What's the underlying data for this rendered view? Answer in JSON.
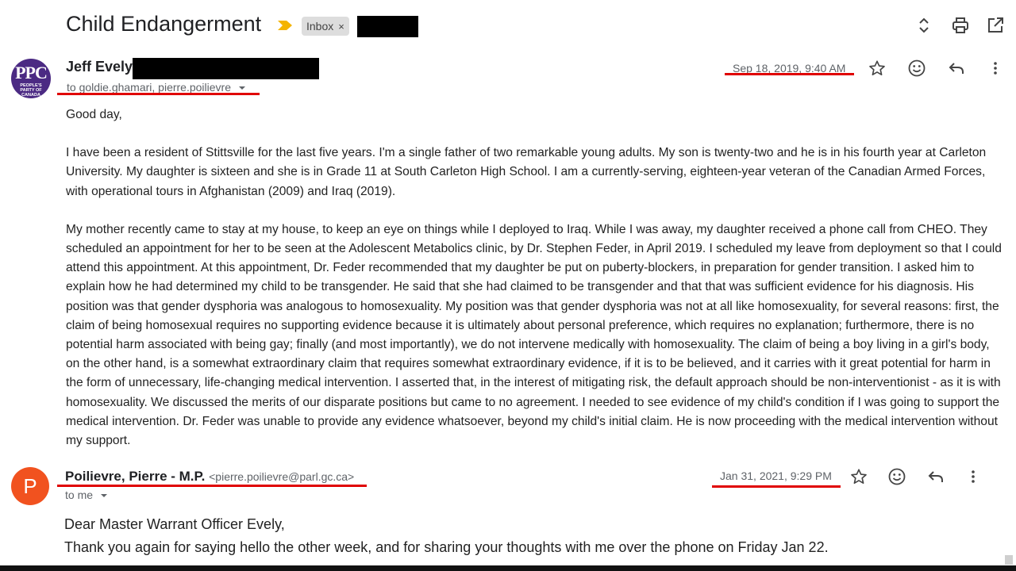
{
  "thread": {
    "subject": "Child Endangerment",
    "label_chip": "Inbox",
    "label_chip_close": "×"
  },
  "message1": {
    "sender_name": "Jeff Evely",
    "avatar_text": "PPC",
    "avatar_subtext": "PEOPLE'S PARTY OF CANADA",
    "recipients": "to goldie.ghamari, pierre.poilievre",
    "date": "Sep 18, 2019, 9:40 AM",
    "body": [
      "Good day,",
      "I have been a resident of Stittsville for the last five years. I'm a single father of two remarkable young adults. My son is twenty-two and he is in his fourth year at Carleton University. My daughter is sixteen and she is in Grade 11 at South Carleton High School. I am a currently-serving, eighteen-year veteran of the Canadian Armed Forces, with operational tours in Afghanistan (2009) and Iraq (2019).",
      "My mother recently came to stay at my house, to keep an eye on things while I deployed to Iraq. While I was away, my daughter received a phone call from CHEO. They scheduled an appointment for her to be seen at the Adolescent Metabolics clinic, by Dr. Stephen Feder, in April 2019. I scheduled my leave from deployment so that I could attend this appointment. At this appointment, Dr. Feder recommended that my daughter be put on puberty-blockers, in preparation for gender transition. I asked him to explain how he had determined my child to be transgender. He said that she had claimed to be transgender and that that was sufficient evidence for his diagnosis. His position was that gender dysphoria was analogous to homosexuality. My position was that gender dysphoria was not at all like homosexuality, for several reasons: first, the claim of being homosexual requires no supporting evidence because it is ultimately about personal preference, which requires no explanation; furthermore, there is no potential harm associated with being gay; finally (and most importantly), we do not intervene medically with homosexuality. The claim of being a boy living in a girl's body, on the other hand, is a somewhat extraordinary claim that requires somewhat extraordinary evidence, if it is to be believed, and it carries with it great potential for harm in the form of unnecessary, life-changing medical intervention. I asserted that, in the interest of mitigating risk, the default approach should be non-interventionist - as it is with homosexuality. We discussed the merits of our disparate positions but came to no agreement. I needed to see evidence of my child's condition if I was going to support the medical intervention. Dr. Feder was unable to provide any evidence whatsoever, beyond my child's initial claim. He is now proceeding with the medical intervention without my support."
    ]
  },
  "message2": {
    "sender_name": "Poilievre, Pierre - M.P.",
    "sender_email": "<pierre.poilievre@parl.gc.ca>",
    "avatar_letter": "P",
    "recipients": "to me",
    "date": "Jan 31, 2021, 9:29 PM",
    "body": [
      "Dear Master Warrant Officer Evely,",
      "Thank you again for saying hello the other week, and for sharing your thoughts with me over the phone on Friday Jan 22."
    ]
  },
  "icons": {
    "thread_toolbar": [
      "expand-collapse-icon",
      "print-icon",
      "open-in-new-window-icon"
    ],
    "message_actions": [
      "star-icon",
      "emoji-reaction-icon",
      "reply-icon",
      "more-vert-icon"
    ]
  },
  "colors": {
    "importance_marker": "#f4b400",
    "avatar_ppc": "#4b2a83",
    "avatar_p": "#f1521f",
    "annotation_underline": "#e00000",
    "redaction": "#000000"
  }
}
